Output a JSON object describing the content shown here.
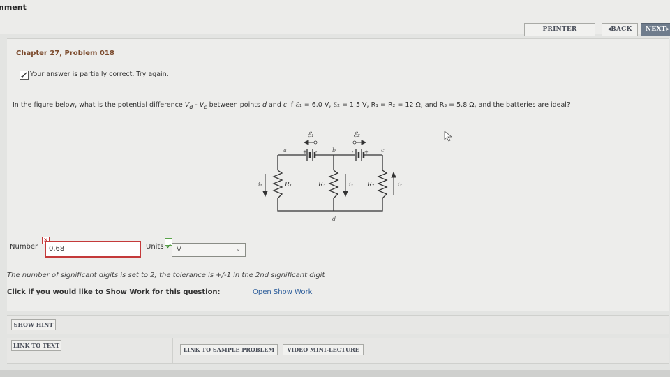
{
  "window": {
    "title": "nment"
  },
  "nav": {
    "printer": "PRINTER VERSION",
    "back": "BACK",
    "next": "NEXT"
  },
  "problem": {
    "title": "Chapter 27, Problem 018"
  },
  "status": {
    "text": "Your answer is partially correct.  Try again."
  },
  "question": {
    "p1": "In the figure below, what is the potential difference ",
    "vd": "V",
    "vd_sub": "d",
    "minus": " - ",
    "vc": "V",
    "vc_sub": "c",
    "p2": " between points ",
    "pd": "d",
    "p3": " and ",
    "pc": "c",
    "p4": " if ℰ₁ = 6.0 V, ℰ₂ = 1.5 V, R₁ = R₂ = 12 Ω, and R₃ = 5.8 Ω, and the batteries are ideal?"
  },
  "figure": {
    "emf1": "ℰ₁",
    "emf2": "ℰ₂",
    "node_a": "a",
    "node_b": "b",
    "node_c": "c",
    "node_d": "d",
    "r1": "R₁",
    "r2": "R₂",
    "r3": "R₃",
    "i1": "i₁",
    "i2": "i₂",
    "i3": "i₃",
    "plus": "+",
    "minus": "-"
  },
  "answer": {
    "number_label": "Number",
    "number_value": "0.68",
    "units_label": "Units",
    "units_value": "V",
    "number_mark": "×"
  },
  "info": {
    "sigfig": "The number of significant digits is set to 2; the tolerance is +/-1 in the 2nd significant digit",
    "showwork": "Click if you would like to Show Work for this question:",
    "showwork_link": "Open Show Work"
  },
  "buttons": {
    "hint": "SHOW HINT",
    "link_text": "LINK TO TEXT",
    "sample": "LINK TO SAMPLE PROBLEM",
    "video": "VIDEO MINI-LECTURE"
  }
}
